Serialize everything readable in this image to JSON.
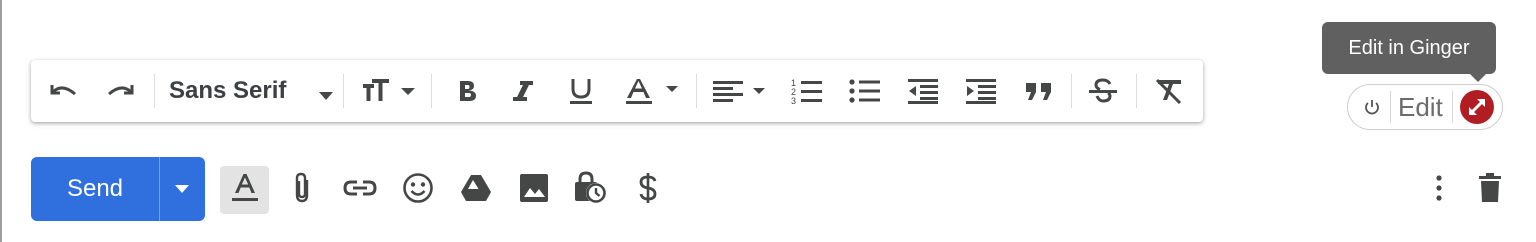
{
  "toolbar": {
    "font_family": "Sans Serif",
    "buttons": [
      "undo",
      "redo",
      "font-size",
      "bold",
      "italic",
      "underline",
      "text-color",
      "align",
      "numbered-list",
      "bulleted-list",
      "indent-less",
      "indent-more",
      "quote",
      "strikethrough",
      "remove-formatting"
    ]
  },
  "ginger": {
    "tooltip": "Edit in Ginger",
    "edit_label": "Edit"
  },
  "compose": {
    "send_label": "Send"
  },
  "colors": {
    "send_blue": "#2f6fde",
    "ginger_red": "#b01e24",
    "tooltip_bg": "#606060",
    "icon_gray": "#444746"
  }
}
